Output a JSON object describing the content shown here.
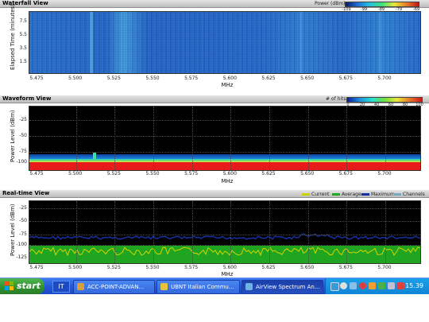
{
  "waterfall": {
    "title": "Waterfall View",
    "legend_label": "Power (dBm):",
    "legend_ticks": [
      "-109",
      "-99",
      "-89",
      "-79",
      "-69"
    ],
    "y_title": "Elapsed Time (minutes)",
    "y_ticks": [
      "7.5",
      "5.5",
      "3.5",
      "1.5"
    ],
    "x_title": "MHz",
    "x_ticks": [
      "5.475",
      "5.500",
      "5.525",
      "5.550",
      "5.575",
      "5.600",
      "5.625",
      "5.650",
      "5.675",
      "5.700"
    ]
  },
  "waveform": {
    "title": "Waveform View",
    "legend_label": "# of hits:",
    "legend_ticks": [
      "0",
      "20",
      "40",
      "60",
      "80",
      "100"
    ],
    "y_title": "Power Level (dBm)",
    "y_ticks": [
      "-25",
      "-50",
      "-75",
      "-100"
    ],
    "x_title": "MHz",
    "x_ticks": [
      "5.475",
      "5.500",
      "5.525",
      "5.550",
      "5.575",
      "5.600",
      "5.625",
      "5.650",
      "5.675",
      "5.700"
    ]
  },
  "realtime": {
    "title": "Real-time View",
    "legend": [
      {
        "label": "Current",
        "color": "#c8d400"
      },
      {
        "label": "Average",
        "color": "#22aa22"
      },
      {
        "label": "Maximum",
        "color": "#1a2fa0"
      },
      {
        "label": "Channels",
        "color": "#7ea8c0"
      }
    ],
    "y_title": "Power Level (dBm)",
    "y_ticks": [
      "-25",
      "-50",
      "-75",
      "-100",
      "-125"
    ],
    "x_title": "MHz",
    "x_ticks": [
      "5.475",
      "5.500",
      "5.525",
      "5.550",
      "5.575",
      "5.600",
      "5.625",
      "5.650",
      "5.675",
      "5.700"
    ]
  },
  "taskbar": {
    "start_label": "start",
    "language": "IT",
    "tasks": [
      {
        "label": "ACC-POINT-ADVAN...",
        "icon": "app-icon",
        "color": "#d8a13a"
      },
      {
        "label": "UBNT Italian Commu...",
        "icon": "chrome-icon",
        "color": "#e8c23a"
      },
      {
        "label": "AirView Spectrum An...",
        "icon": "airview-icon",
        "color": "#6bb3e0"
      }
    ],
    "clock": "15.39"
  }
}
